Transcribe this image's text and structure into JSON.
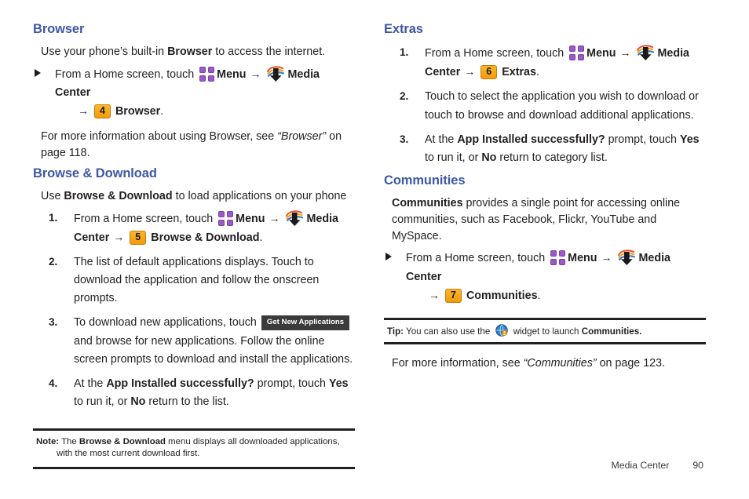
{
  "document": {
    "footer": {
      "chapter": "Media Center",
      "page_number": "90"
    }
  },
  "left_column": {
    "browser": {
      "heading": "Browser",
      "intro_1": "Use your phone’s built-in ",
      "intro_bold": "Browser",
      "intro_2": " to access the internet.",
      "step_1": "From a Home screen, touch ",
      "menu_label": "Menu",
      "arrow": "→",
      "media_center_label": "Media Center",
      "badge_number": "4",
      "target_label": "Browser",
      "period": ".",
      "more_info_1": "For more information about using Browser, see ",
      "more_info_ref": "“Browser”",
      "more_info_2": " on page 118."
    },
    "browse_download": {
      "heading": "Browse & Download",
      "intro_1": "Use ",
      "intro_bold": "Browse & Download",
      "intro_2": " to load applications on your phone",
      "steps": [
        {
          "number": "1.",
          "text_1": "From a Home screen, touch ",
          "menu_label": "Menu",
          "media_center_label_a": "Media",
          "media_center_label_b": "Center",
          "badge_number": "5",
          "target_label": "Browse & Download",
          "period": "."
        },
        {
          "number": "2.",
          "text": "The list of default applications displays. Touch to download the application and follow the onscreen prompts."
        },
        {
          "number": "3.",
          "text_1": "To download new applications, touch ",
          "button_label": "Get New Applications",
          "text_2": " and browse for new applications. Follow the online screen prompts to download and install the applications."
        },
        {
          "number": "4.",
          "text_1": "At the ",
          "bold_1": "App Installed successfully?",
          "text_2": " prompt, touch ",
          "bold_2": "Yes",
          "text_3": " to run it, or ",
          "bold_3": "No",
          "text_4": " return to the list."
        }
      ],
      "note": {
        "label": "Note:",
        "line_1": " The ",
        "bold_1": "Browse & Download",
        "line_2": " menu displays all downloaded applications,",
        "line_3": "with the most current download first."
      }
    }
  },
  "right_column": {
    "extras": {
      "heading": "Extras",
      "steps": [
        {
          "number": "1.",
          "text_1": "From a Home screen, touch ",
          "menu_label": "Menu",
          "media_center_label_a": "Media",
          "media_center_label_b": "Center",
          "badge_number": "6",
          "target_label": "Extras",
          "period": "."
        },
        {
          "number": "2.",
          "text": "Touch to select the application you wish to download or touch  to browse and download additional applications."
        },
        {
          "number": "3.",
          "text_1": "At the ",
          "bold_1": "App Installed successfully?",
          "text_2": " prompt, touch ",
          "bold_2": "Yes",
          "text_3": " to run it, or ",
          "bold_3": "No",
          "text_4": " return to category list."
        }
      ]
    },
    "communities": {
      "heading": "Communities",
      "intro_bold": "Communities",
      "intro_1": " provides a single point for accessing online communities, such as Facebook, Flickr, YouTube and MySpace.",
      "step_1": "From a Home screen, touch ",
      "menu_label": "Menu",
      "arrow": "→",
      "media_center_label": "Media Center",
      "badge_number": "7",
      "target_label": "Communities",
      "period": ".",
      "tip": {
        "label": "Tip:",
        "text_1": " You can also use the ",
        "text_2": " widget to launch ",
        "bold_1": "Communities."
      },
      "more_info_1": "For more information, see ",
      "more_info_ref": "“Communities”",
      "more_info_2": " on page 123."
    }
  },
  "colors": {
    "heading_blue": "#3d58a4",
    "badge_orange": "#f5a61a",
    "menu_purple": "#9b59c6",
    "body_text": "#231f20",
    "ui_button_bg": "#3b3b3b"
  }
}
